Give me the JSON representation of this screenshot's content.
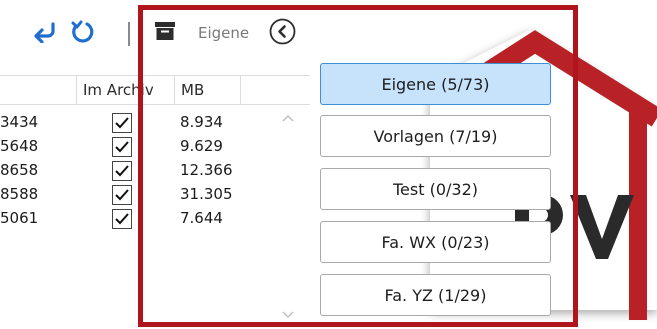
{
  "toolbar": {
    "icons": [
      "undo-icon",
      "reload-icon",
      "archive-icon",
      "chevron-left-icon"
    ],
    "filter_label": "Eigene",
    "accent": "#1f6fd1"
  },
  "grid": {
    "columns": [
      "",
      "Im Archiv",
      "MB"
    ],
    "rows": [
      {
        "id": "3434",
        "archived": true,
        "mb": "8.934"
      },
      {
        "id": "5648",
        "archived": true,
        "mb": "9.629"
      },
      {
        "id": "8658",
        "archived": true,
        "mb": "12.366"
      },
      {
        "id": "8588",
        "archived": true,
        "mb": "31.305"
      },
      {
        "id": "5061",
        "archived": true,
        "mb": "7.644"
      }
    ]
  },
  "filters": [
    {
      "label": "Eigene (5/73)",
      "active": true
    },
    {
      "label": "Vorlagen (7/19)",
      "active": false
    },
    {
      "label": "Test (0/32)",
      "active": false
    },
    {
      "label": "Fa. WX (0/23)",
      "active": false
    },
    {
      "label": "Fa. YZ (1/29)",
      "active": false
    }
  ],
  "colors": {
    "highlight_frame": "#b0141d",
    "active_filter_bg": "#c6e3fb",
    "active_filter_border": "#3d8fd6",
    "logo_red": "#b82226"
  }
}
